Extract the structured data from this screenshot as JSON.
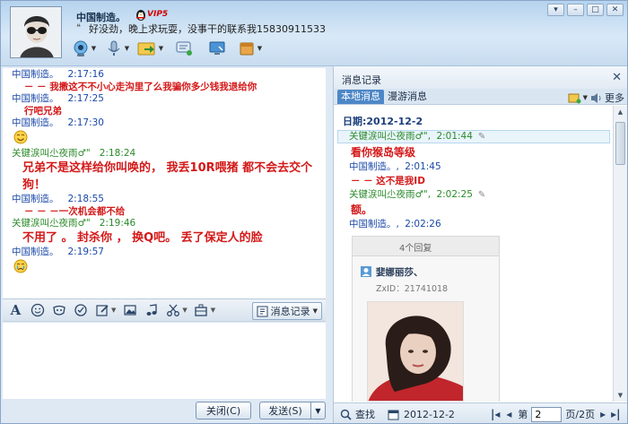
{
  "header": {
    "contact_name": "中国制造。",
    "vip_label": "VIP5",
    "status_message": "好没劲，晚上求玩耍，没事干的联系我15830911533"
  },
  "chat": {
    "messages": [
      {
        "sender": "中国制造。",
        "time": "2:17:16",
        "text": "－ － 我撒这不不小心走沟里了么我骗你多少钱我退给你",
        "style": "small"
      },
      {
        "sender": "中国制造。",
        "time": "2:17:25",
        "text": "行吧兄弟",
        "style": "small"
      },
      {
        "sender": "中国制造。",
        "time": "2:17:30",
        "text": "",
        "style": "emoji-smile"
      },
      {
        "sender": "关键涙叫尐夜雨♂\"",
        "time": "2:18:24",
        "text": "兄弟不是这样给你叫唤的， 我丢10R喂猪  都不会去交个狗！",
        "style": "big"
      },
      {
        "sender": "中国制造。",
        "time": "2:18:55",
        "text": "－ － －一次机会都不给",
        "style": "small"
      },
      {
        "sender": "关键涙叫尐夜雨♂\"",
        "time": "2:19:46",
        "text": "不用了 。 封杀你 ， 换Q吧。  丢了保定人的脸",
        "style": "big"
      },
      {
        "sender": "中国制造。",
        "time": "2:19:57",
        "text": "",
        "style": "emoji-cry"
      }
    ]
  },
  "format_bar": {
    "history_button": "消息记录"
  },
  "bottom": {
    "close_button": "关闭(C)",
    "send_button": "发送(S)"
  },
  "history": {
    "title": "消息记录",
    "tabs": [
      "本地消息",
      "漫游消息"
    ],
    "more_label": "更多",
    "date_label": "日期:2012-12-2",
    "records": [
      {
        "sender": "关键涙叫尐夜雨♂\"",
        "time": "2:01:44",
        "text": "看你猴岛等级",
        "selected": true
      },
      {
        "sender": "中国制造。",
        "time": "2:01:45",
        "text": "－ － 这不是我ID"
      },
      {
        "sender": "关键涙叫尐夜雨♂\"",
        "time": "2:02:25",
        "text": "额。"
      },
      {
        "sender": "中国制造。",
        "time": "2:02:26",
        "text": ""
      }
    ],
    "embed": {
      "reply_count": "4个回复",
      "user_name": "婓娜丽莎、",
      "zx_id": "ZxID：21741018"
    },
    "footer": {
      "search_label": "查找",
      "date_value": "2012-12-2",
      "page_prefix": "第",
      "page_value": "2",
      "page_suffix": "页/2页"
    }
  }
}
